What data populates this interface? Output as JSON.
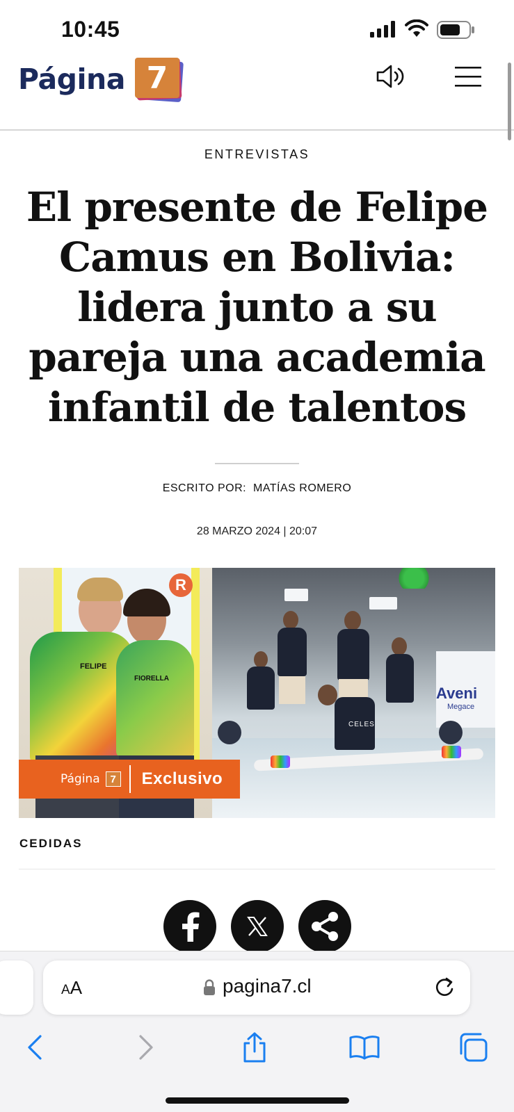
{
  "status_bar": {
    "time": "10:45"
  },
  "header": {
    "logo_text": "Página",
    "logo_number": "7",
    "speaker_icon": "speaker-icon",
    "menu_icon": "hamburger-menu-icon"
  },
  "article": {
    "category": "ENTREVISTAS",
    "headline": "El presente de Felipe Camus en Bolivia: lidera junto a su pareja una academia infantil de talentos",
    "byline_label": "ESCRITO POR:",
    "byline_author": "MATÍAS ROMERO",
    "date": "28 MARZO 2024 | 20:07",
    "image": {
      "shirt_left": "FELIPE",
      "shirt_right": "FIORELLA",
      "banner_brand": "Página",
      "banner_number": "7",
      "banner_label": "Exclusivo",
      "kid_shirt": "CELES",
      "sign_text": "Aveni",
      "sign_sub": "Megace"
    },
    "caption": "CEDIDAS"
  },
  "share": {
    "facebook": "facebook-icon",
    "x": "x-icon",
    "share": "share-icon"
  },
  "browser": {
    "aa_label": "AA",
    "url": "pagina7.cl"
  },
  "colors": {
    "brand_navy": "#1b2a5c",
    "brand_orange": "#e8621f",
    "ios_blue": "#1a7ff0"
  }
}
